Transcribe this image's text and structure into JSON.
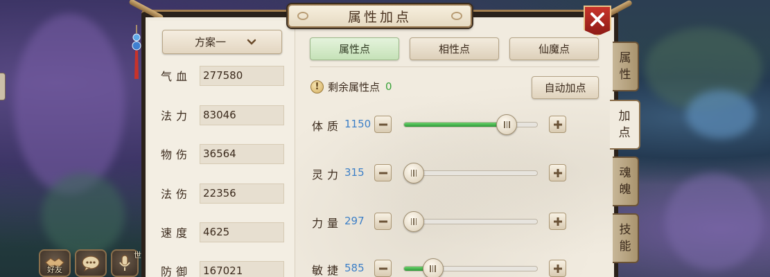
{
  "window": {
    "title": "属性加点"
  },
  "scheme": {
    "label": "方案一"
  },
  "stats": [
    {
      "name": "气血",
      "value": "277580"
    },
    {
      "name": "法力",
      "value": "83046"
    },
    {
      "name": "物伤",
      "value": "36564"
    },
    {
      "name": "法伤",
      "value": "22356"
    },
    {
      "name": "速度",
      "value": "4625"
    },
    {
      "name": "防御",
      "value": "167021"
    }
  ],
  "tabs": [
    {
      "label": "属性点",
      "active": true
    },
    {
      "label": "相性点",
      "active": false
    },
    {
      "label": "仙魔点",
      "active": false
    }
  ],
  "remaining": {
    "label": "剩余属性点",
    "value": "0"
  },
  "auto_button": {
    "label": "自动加点"
  },
  "attributes": [
    {
      "name": "体质",
      "value": "1150",
      "level": 0.77
    },
    {
      "name": "灵力",
      "value": "315",
      "level": 0.0
    },
    {
      "name": "力量",
      "value": "297",
      "level": 0.0
    },
    {
      "name": "敏捷",
      "value": "585",
      "level": 0.22
    }
  ],
  "side_tabs": [
    {
      "label": [
        "属",
        "性"
      ],
      "active": false
    },
    {
      "label": [
        "加",
        "点"
      ],
      "active": true
    },
    {
      "label": [
        "魂",
        "魄"
      ],
      "active": false
    },
    {
      "label": [
        "技",
        "能"
      ],
      "active": false
    }
  ],
  "hud": {
    "friends_label": "好友",
    "voice_tag": "世"
  },
  "colors": {
    "accent_green": "#3aa23a",
    "value_blue": "#3c7fc7",
    "close_red": "#c8332a"
  }
}
